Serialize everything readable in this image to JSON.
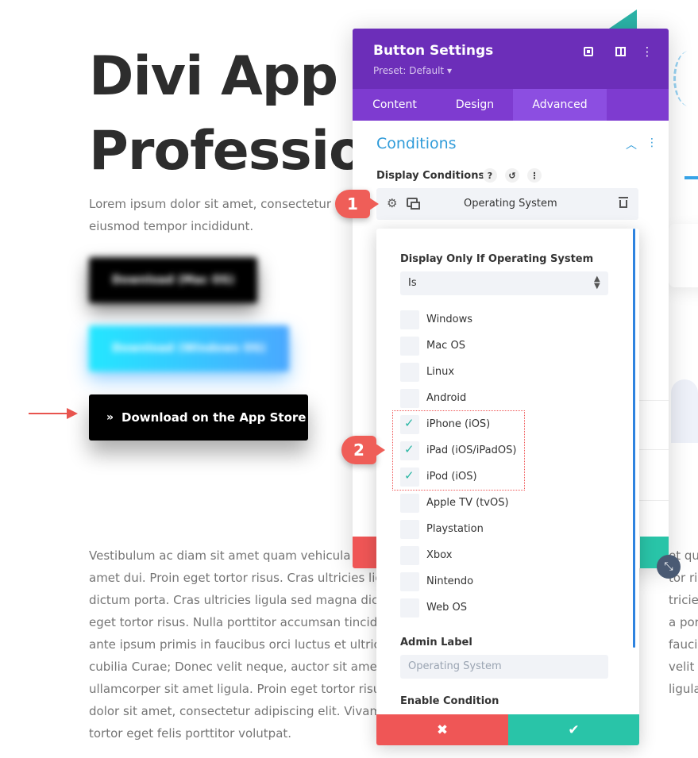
{
  "background_page": {
    "title_line1": "Divi App f",
    "title_line2": "Professio",
    "lead": "Lorem ipsum dolor sit amet, consectetur a… eiusmod tempor incididunt.",
    "lead_line1": "Lorem ipsum dolor sit amet, consectetur a",
    "lead_line2": "eiusmod tempor incididunt.",
    "btn_mac_label": "Download (Mac OS)",
    "btn_windows_label": "Download (Windows OS)",
    "btn_appstore_label": "Download on the App Store",
    "btn_appstore_icon": "double-chevron-right-icon",
    "body_lines": [
      "Vestibulum ac diam sit amet quam vehicula e",
      "amet dui. Proin eget tortor risus. Cras ultricies lig",
      "dictum porta. Cras ultricies ligula sed magna dictu",
      "eget tortor risus. Nulla porttitor accumsan tincidu",
      "ante ipsum primis in faucibus orci luctus et ultrice",
      "cubilia Curae; Donec velit neque, auctor sit amet",
      "ullamcorper sit amet ligula. Proin eget tortor risu",
      "dolor sit amet, consectetur adipiscing elit. Vivamu",
      "tortor eget felis porttitor volutpat."
    ],
    "body_right_fragments": [
      "et qu",
      "tor risu",
      "tricies ligu",
      "a porttitor",
      "faucibus o",
      "velit nequ",
      "ligula. Pro"
    ],
    "arrow_color": "#e8544e"
  },
  "modal": {
    "title": "Button Settings",
    "preset": "Preset: Default",
    "preset_caret": "▾",
    "header_color": "#6c2eb9",
    "tabs": [
      {
        "label": "Content"
      },
      {
        "label": "Design"
      },
      {
        "label": "Advanced"
      }
    ],
    "active_tab": "Advanced",
    "section_title": "Conditions",
    "display_conditions_label": "Display Conditions",
    "condition_row_label": "Operating System",
    "accent_color": "#2f9bd9"
  },
  "popup": {
    "field_label": "Display Only If Operating System",
    "select_value": "Is",
    "os_options": [
      {
        "label": "Windows",
        "checked": false
      },
      {
        "label": "Mac OS",
        "checked": false
      },
      {
        "label": "Linux",
        "checked": false
      },
      {
        "label": "Android",
        "checked": false
      },
      {
        "label": "iPhone (iOS)",
        "checked": true
      },
      {
        "label": "iPad (iOS/iPadOS)",
        "checked": true
      },
      {
        "label": "iPod (iOS)",
        "checked": true
      },
      {
        "label": "Apple TV (tvOS)",
        "checked": false
      },
      {
        "label": "Playstation",
        "checked": false
      },
      {
        "label": "Xbox",
        "checked": false
      },
      {
        "label": "Nintendo",
        "checked": false
      },
      {
        "label": "Web OS",
        "checked": false
      }
    ],
    "admin_label": "Admin Label",
    "admin_placeholder": "Operating System",
    "enable_condition_label": "Enable Condition",
    "cancel_icon": "✖",
    "save_icon": "✔",
    "check_color": "#29b6a4",
    "cancel_color": "#ef5656",
    "save_color": "#29c4a8"
  },
  "callouts": {
    "one": "1",
    "two": "2",
    "color": "#ef5e58"
  }
}
